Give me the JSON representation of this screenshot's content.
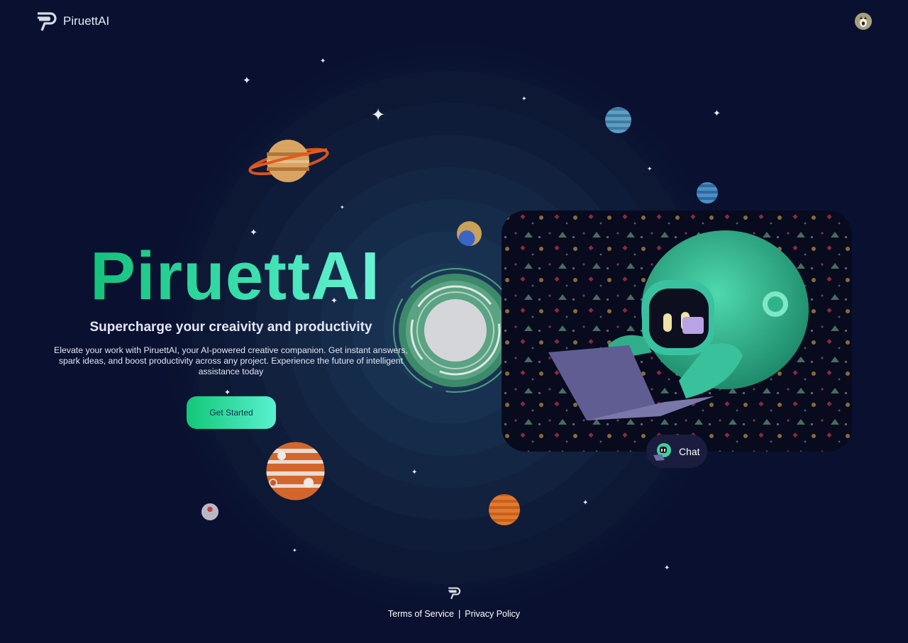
{
  "header": {
    "brand": "PiruettAI",
    "logo_icon": "piruett-logo-icon",
    "avatar_icon": "user-avatar-icon"
  },
  "hero": {
    "title": "PiruettAI",
    "subtitle": "Supercharge your creaivity and productivity",
    "description": "Elevate your work with PiruettAI, your AI-powered creative companion. Get instant answers, spark ideas, and boost productivity across any project. Experience the future of intelligent assistance today",
    "cta_label": "Get Started"
  },
  "chat": {
    "label": "Chat",
    "icon": "robot-chat-icon"
  },
  "footer": {
    "terms": "Terms of Service",
    "separator": "|",
    "privacy": "Privacy Policy"
  },
  "colors": {
    "background": "#0a1130",
    "accent_start": "#12c779",
    "accent_end": "#58f2cf",
    "card_bg": "#080b1e",
    "chip_bg": "#1a1d3e"
  }
}
